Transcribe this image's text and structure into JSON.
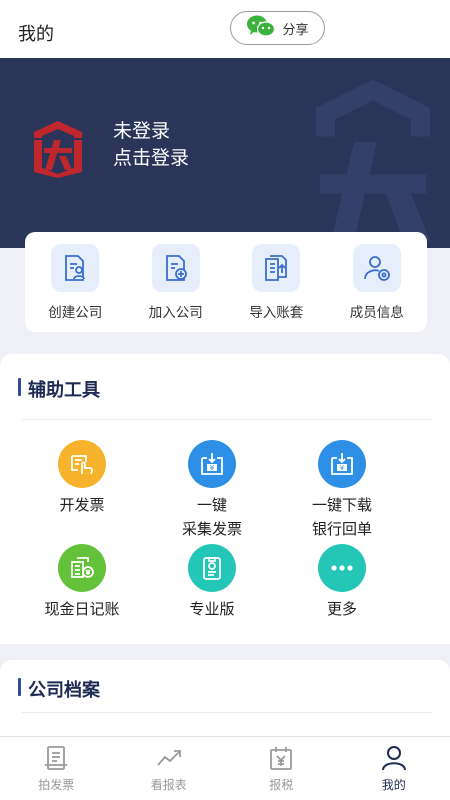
{
  "header": {
    "title": "我的",
    "share_label": "分享"
  },
  "user": {
    "status": "未登录",
    "action": "点击登录"
  },
  "quick_actions": [
    {
      "label": "创建公司",
      "icon": "create-company-icon"
    },
    {
      "label": "加入公司",
      "icon": "join-company-icon"
    },
    {
      "label": "导入账套",
      "icon": "import-ledger-icon"
    },
    {
      "label": "成员信息",
      "icon": "member-info-icon"
    }
  ],
  "tools": {
    "title": "辅助工具",
    "items": [
      {
        "label": "开发票",
        "icon": "invoice-hand-icon",
        "color": "#f7b32b"
      },
      {
        "label": "一键\n采集发票",
        "icon": "collect-invoice-icon",
        "color": "#2d8fe6"
      },
      {
        "label": "一键下载\n银行回单",
        "icon": "bank-receipt-icon",
        "color": "#2d8fe6"
      },
      {
        "label": "现金日记账",
        "icon": "cash-journal-icon",
        "color": "#63c13a"
      },
      {
        "label": "专业版",
        "icon": "pro-version-icon",
        "color": "#23c6b7"
      },
      {
        "label": "更多",
        "icon": "more-icon",
        "color": "#23c6b7"
      }
    ]
  },
  "archive": {
    "title": "公司档案"
  },
  "tabbar": [
    {
      "label": "拍发票",
      "icon": "invoice-photo-icon",
      "active": false
    },
    {
      "label": "看报表",
      "icon": "chart-trend-icon",
      "active": false
    },
    {
      "label": "报税",
      "icon": "tax-calendar-icon",
      "active": false
    },
    {
      "label": "我的",
      "icon": "person-icon",
      "active": true
    }
  ],
  "colors": {
    "banner": "#2a3559",
    "accent": "#1f2b55",
    "logo_red": "#c0272d"
  }
}
